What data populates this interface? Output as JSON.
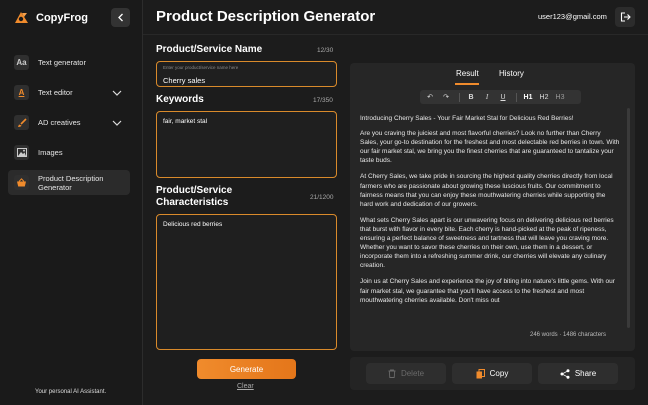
{
  "app": {
    "name": "CopyFrog",
    "tagline": "Your personal AI Assistant."
  },
  "sidebar": {
    "items": [
      {
        "label": "Text generator",
        "icon": "text-generator-icon",
        "glyph": "Aa",
        "has_chevron": false,
        "active": false
      },
      {
        "label": "Text editor",
        "icon": "text-editor-icon",
        "glyph": "A",
        "has_chevron": true,
        "active": false
      },
      {
        "label": "AD creatives",
        "icon": "brush-icon",
        "glyph": "",
        "has_chevron": true,
        "active": false
      },
      {
        "label": "Images",
        "icon": "image-icon",
        "glyph": "",
        "has_chevron": false,
        "active": false
      },
      {
        "label": "Product Description Generator",
        "icon": "basket-icon",
        "glyph": "",
        "has_chevron": false,
        "active": true
      }
    ]
  },
  "header": {
    "title": "Product Description Generator",
    "user_email": "user123@gmail.com"
  },
  "form": {
    "name": {
      "title": "Product/Service Name",
      "counter": "12/30",
      "hint": "Enter your product/service name here",
      "value": "Cherry sales"
    },
    "keywords": {
      "title": "Keywords",
      "counter": "17/350",
      "value": "fair, market stal"
    },
    "characteristics": {
      "title": "Product/Service Characteristics",
      "counter": "21/1200",
      "value": "Delicious red berries"
    },
    "generate_label": "Generate",
    "clear_label": "Clear"
  },
  "result": {
    "tabs": [
      "Result",
      "History"
    ],
    "active_tab": "Result",
    "toolbar": {
      "undo": "↶",
      "redo": "↷",
      "bold": "B",
      "italic": "I",
      "underline": "U",
      "h1": "H1",
      "h2": "H2",
      "h3": "H3"
    },
    "paragraphs": [
      "Introducing Cherry Sales - Your Fair Market Stal for Delicious Red Berries!",
      "Are you craving the juiciest and most flavorful cherries? Look no further than Cherry Sales, your go-to destination for the freshest and most delectable red berries in town. With our fair market stal, we bring you the finest cherries that are guaranteed to tantalize your taste buds.",
      "At Cherry Sales, we take pride in sourcing the highest quality cherries directly from local farmers who are passionate about growing these luscious fruits. Our commitment to fairness means that you can enjoy these mouthwatering cherries while supporting the hard work and dedication of our growers.",
      "What sets Cherry Sales apart is our unwavering focus on delivering delicious red berries that burst with flavor in every bite. Each cherry is hand-picked at the peak of ripeness, ensuring a perfect balance of sweetness and tartness that will leave you craving more. Whether you want to savor these cherries on their own, use them in a dessert, or incorporate them into a refreshing summer drink, our cherries will elevate any culinary creation.",
      "Join us at Cherry Sales and experience the joy of biting into nature's little gems. With our fair market stal, we guarantee that you'll have access to the freshest and most mouthwatering cherries available. Don't miss out"
    ],
    "counts": "246 words · 1486 characters"
  },
  "actions": {
    "delete": "Delete",
    "copy": "Copy",
    "share": "Share"
  },
  "colors": {
    "accent": "#f08b2c",
    "field_border": "#d98a2b",
    "background": "#1c1c1c"
  }
}
